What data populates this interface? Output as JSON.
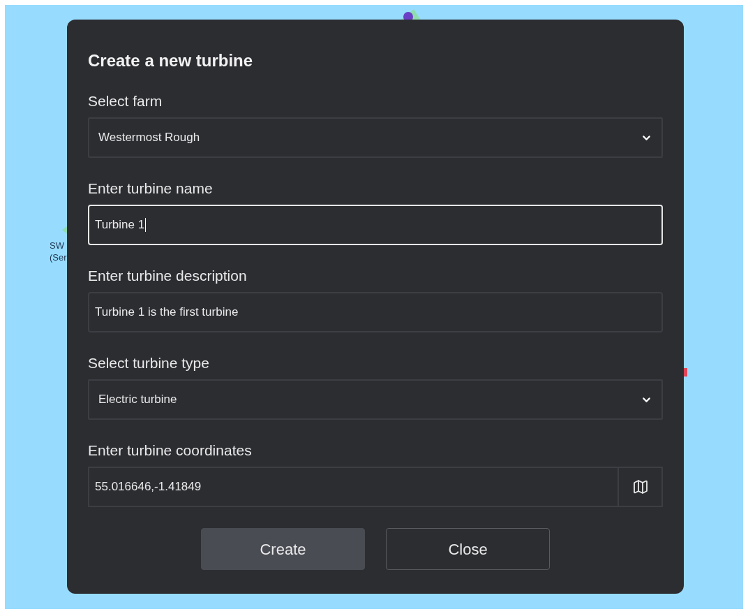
{
  "map": {
    "markers": [
      {
        "name": "SW",
        "status": "(Ser"
      }
    ]
  },
  "dialog": {
    "title": "Create a new turbine",
    "fields": [
      {
        "kind": "select",
        "label": "Select farm",
        "value": "Westermost Rough",
        "focused": false
      },
      {
        "kind": "text",
        "label": "Enter turbine name",
        "value": "Turbine 1",
        "focused": true
      },
      {
        "kind": "text",
        "label": "Enter turbine description",
        "value": "Turbine 1 is the first turbine",
        "focused": false
      },
      {
        "kind": "select",
        "label": "Select turbine type",
        "value": "Electric turbine",
        "focused": false
      },
      {
        "kind": "map",
        "label": "Enter turbine coordinates",
        "value": "55.016646,-1.41849",
        "focused": false
      }
    ],
    "buttons": [
      {
        "label": "Create",
        "kind": "primary"
      },
      {
        "label": "Close",
        "kind": "secondary"
      }
    ]
  }
}
